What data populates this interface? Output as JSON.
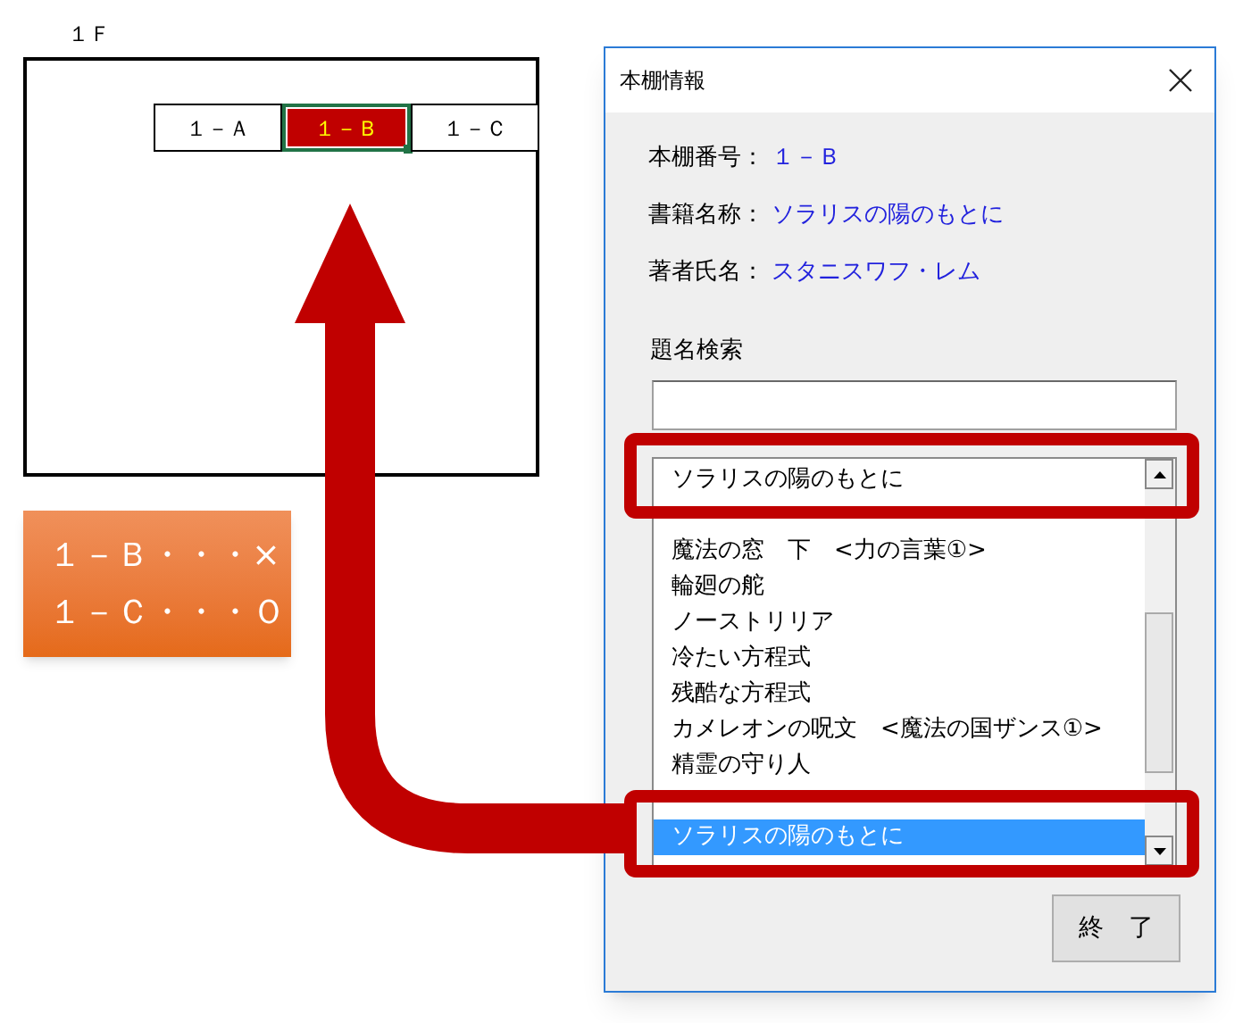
{
  "floor_plan": {
    "floor_label": "１Ｆ",
    "shelves": [
      {
        "label": "１－Ａ",
        "selected": false
      },
      {
        "label": "１－Ｂ",
        "selected": true
      },
      {
        "label": "１－Ｃ",
        "selected": false
      }
    ]
  },
  "note": {
    "lines": [
      "１－Ｂ・・・×",
      "１－Ｃ・・・Ｏ"
    ]
  },
  "dialog": {
    "title": "本棚情報",
    "fields": [
      {
        "label": "本棚番号：",
        "value": "１－Ｂ"
      },
      {
        "label": "書籍名称：",
        "value": "ソラリスの陽のもとに"
      },
      {
        "label": "著者氏名：",
        "value": "スタニスワフ・レム"
      }
    ],
    "search": {
      "label": "題名検索"
    },
    "list": {
      "items": [
        {
          "text": "ソラリスの陽のもとに",
          "selected": false
        },
        {
          "text": "魔法の窓　下　<力の言葉①>",
          "selected": false
        },
        {
          "text": "輪廻の舵",
          "selected": false
        },
        {
          "text": "ノーストリリア",
          "selected": false
        },
        {
          "text": "冷たい方程式",
          "selected": false
        },
        {
          "text": "残酷な方程式",
          "selected": false
        },
        {
          "text": "カメレオンの呪文　<魔法の国ザンス①>",
          "selected": false
        },
        {
          "text": "精霊の守り人",
          "selected": false
        },
        {
          "text": "ソラリスの陽のもとに",
          "selected": true
        }
      ]
    },
    "close_button": "終　了"
  }
}
